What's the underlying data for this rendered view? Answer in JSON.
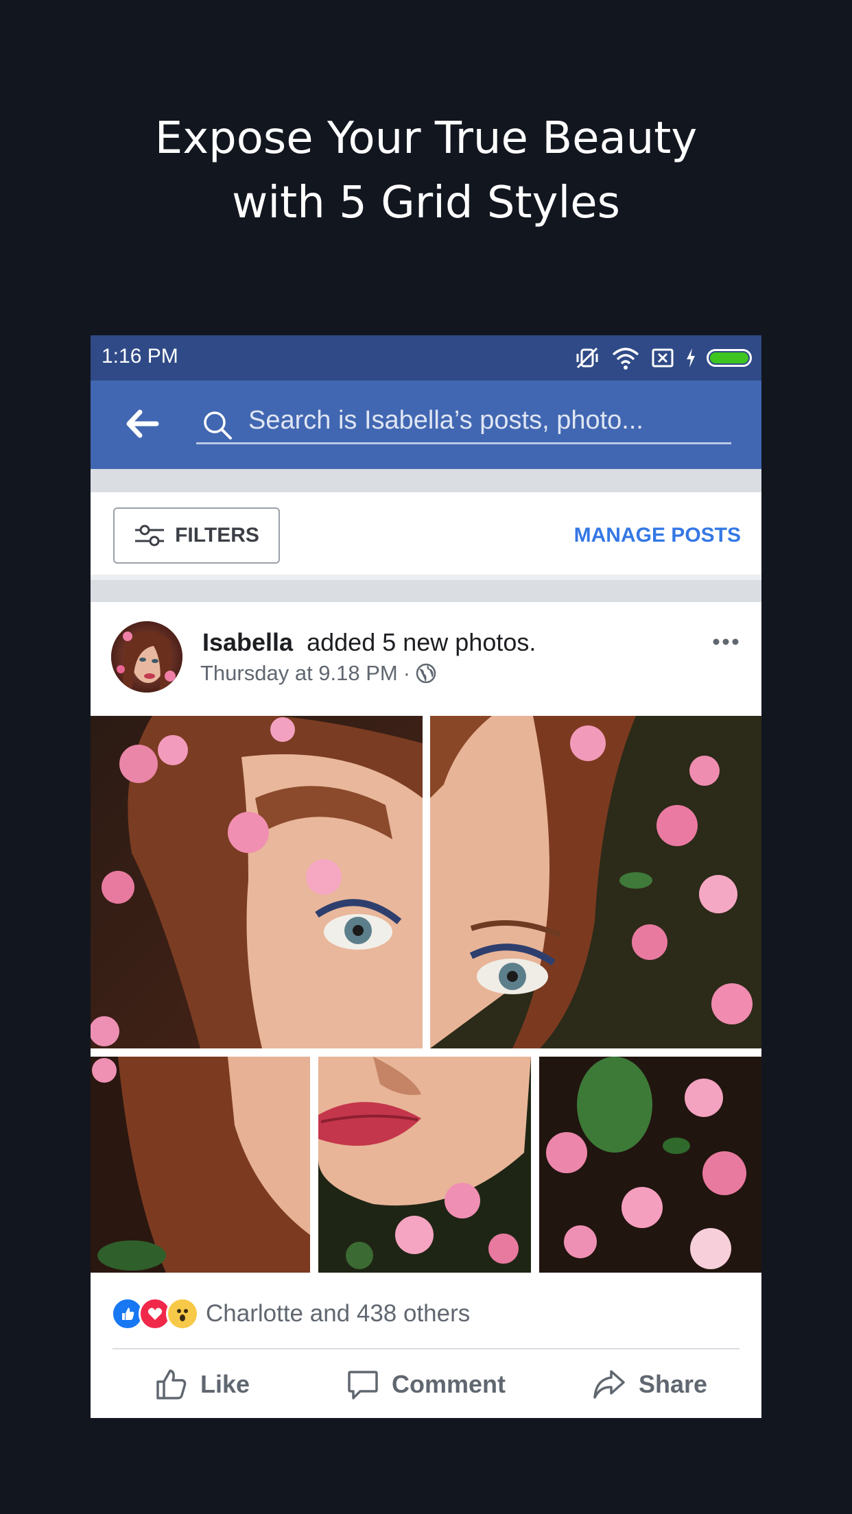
{
  "promo": {
    "line1": "Expose Your True Beauty",
    "line2": "with 5 Grid Styles"
  },
  "status_bar": {
    "time": "1:16 PM",
    "icons": [
      "vibrate-off-icon",
      "wifi-icon",
      "no-sim-icon",
      "charging-bolt-icon",
      "battery-icon"
    ],
    "battery_color": "#3ec51f"
  },
  "search": {
    "placeholder": "Search is Isabella’s posts, photo..."
  },
  "toolbar": {
    "filters_label": "FILTERS",
    "manage_posts_label": "MANAGE POSTS"
  },
  "post": {
    "author": "Isabella",
    "action_text": "added 5 new photos.",
    "timestamp": "Thursday at 9.18 PM",
    "separator": "·",
    "photo_count": 5
  },
  "reactions": {
    "icons": [
      "like-reaction-icon",
      "love-reaction-icon",
      "wow-reaction-icon"
    ],
    "summary": "Charlotte and 438 others"
  },
  "actions": {
    "like": "Like",
    "comment": "Comment",
    "share": "Share"
  },
  "colors": {
    "background": "#12161f",
    "status_bar": "#2f4a86",
    "header": "#4267b2",
    "link": "#3578e5"
  }
}
